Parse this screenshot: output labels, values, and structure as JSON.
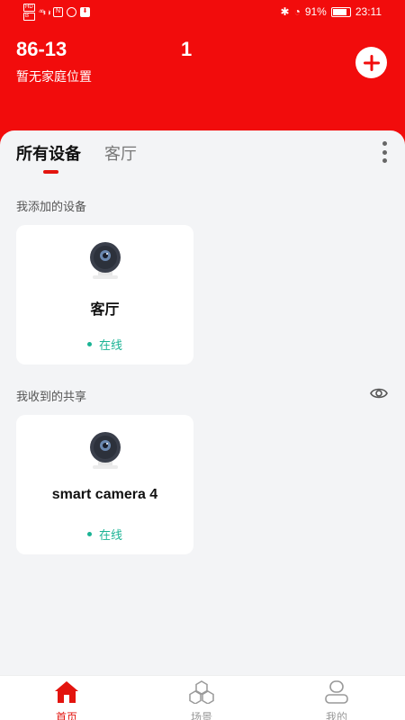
{
  "status_bar": {
    "hd_left": "HD",
    "hd_right": "B",
    "signal_1": "⁴⁶ᵢₗₗ",
    "signal_2": "ᵢₗₗ",
    "battery_text": "91%",
    "battery_level": 0.91,
    "time": "23:11"
  },
  "header": {
    "home_id": "86-13",
    "home_num": "1",
    "subtitle": "暂无家庭位置"
  },
  "tabs": [
    "所有设备",
    "客厅"
  ],
  "sections": {
    "added": "我添加的设备",
    "shared": "我收到的共享"
  },
  "devices_added": [
    {
      "name": "客厅",
      "status": "在线"
    }
  ],
  "devices_shared": [
    {
      "name": "smart camera 4",
      "status": "在线"
    }
  ],
  "bottom_nav": [
    {
      "label": "首页",
      "icon": "home-icon",
      "active": true
    },
    {
      "label": "场景",
      "icon": "scene-icon",
      "active": false
    },
    {
      "label": "我的",
      "icon": "profile-icon",
      "active": false
    }
  ],
  "colors": {
    "accent": "#f20c0c",
    "online": "#1ab394"
  }
}
